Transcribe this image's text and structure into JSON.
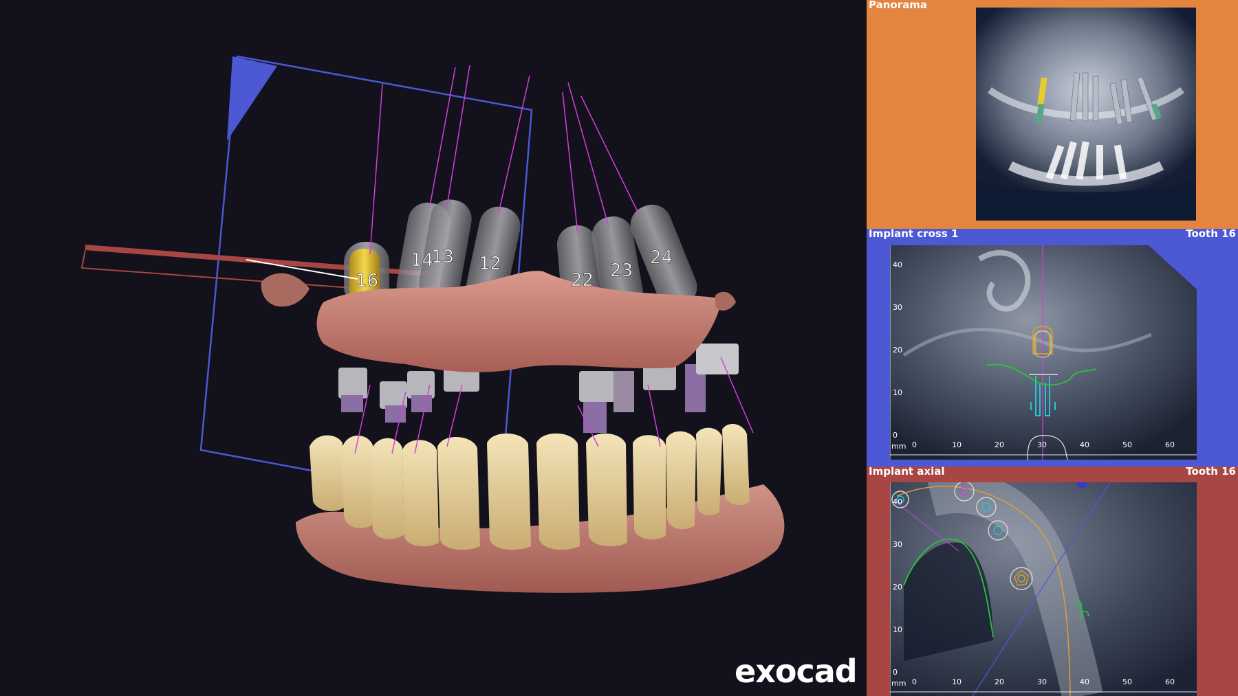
{
  "brand": {
    "logo_text": "exocad"
  },
  "viewport": {
    "implants": [
      {
        "label": "16",
        "color": "#d7b837"
      },
      {
        "label": "14",
        "color": "#9a9a9a"
      },
      {
        "label": "13",
        "color": "#9a9a9a"
      },
      {
        "label": "12",
        "color": "#9a9a9a"
      },
      {
        "label": "22",
        "color": "#9a9a9a"
      },
      {
        "label": "23",
        "color": "#9a9a9a"
      },
      {
        "label": "24",
        "color": "#9a9a9a"
      }
    ],
    "colors": {
      "plane_blue": "#4c58d4",
      "plane_red": "#a84643",
      "axis_magenta": "#d040d8",
      "gum": "#c97f73",
      "teeth": "#e9d4a0"
    }
  },
  "panels": {
    "panorama": {
      "title": "Panorama",
      "bg": "#e3843f"
    },
    "cross": {
      "title": "Implant cross 1",
      "tooth": "Tooth 16",
      "bg": "#4c58d4",
      "y_ticks": [
        "40",
        "30",
        "20",
        "10",
        "0"
      ],
      "x_ticks": [
        "0",
        "10",
        "20",
        "30",
        "40",
        "50",
        "60"
      ],
      "unit": "mm"
    },
    "axial": {
      "title": "Implant axial",
      "tooth": "Tooth 16",
      "bg": "#a84643",
      "y_ticks": [
        "40",
        "30",
        "20",
        "10",
        "0"
      ],
      "x_ticks": [
        "0",
        "10",
        "20",
        "30",
        "40",
        "50",
        "60"
      ],
      "unit": "mm"
    }
  }
}
